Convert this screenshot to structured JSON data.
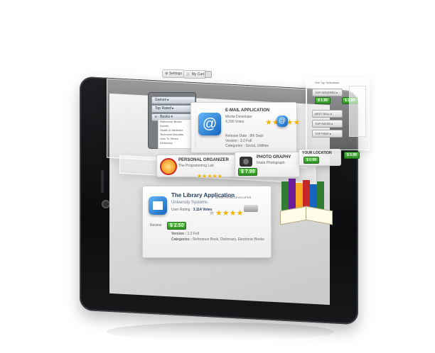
{
  "top_buttons": {
    "settings": "Settings",
    "cart": "My Cart"
  },
  "menu": {
    "items": [
      "Games ▸",
      "Top Rated ▸",
      "e - Books ▾"
    ],
    "sub_items": [
      "Reference Books",
      "Novels",
      "Health & Medicine",
      "Technical Manuals",
      "How To Series",
      "Dictionary"
    ]
  },
  "email_app": {
    "title": "E-MAIL APPLICATION",
    "publisher": "Media Developer",
    "rating": "4,290 Votes",
    "details": [
      "Release Date : 8th Sept",
      "Version : 3.0 Full",
      "Categories : Social, Utilities"
    ],
    "colors": {
      "icon": "#1e88e5"
    }
  },
  "personal_organizer": {
    "title": "PERSONAL ORGANIZER",
    "publisher": "The Programming Lab"
  },
  "photography": {
    "title": "PHOTO GRAPHY",
    "publisher": "Imala Photograph",
    "price": "$ 7.99"
  },
  "your_location": {
    "title": "YOUR LOCATION",
    "price": "$ 0.99"
  },
  "library_app": {
    "title": "The Library Application",
    "publisher": "University Systems",
    "user_rating_label": "User Rating :",
    "user_rating_value": "3,114 Votes",
    "more_label": "MORE FROM DEVELOPER",
    "review_label": "Review",
    "price": "$ 2.50",
    "version_label": "Version :",
    "version_value": "2.3 Full",
    "categories_label": "Categories :",
    "categories_value": "Reference Book, Dictionary, Electronic Books",
    "colors": {
      "icon": "#1e88e5"
    }
  },
  "right_panel": {
    "header": "See Top Selections",
    "items": [
      "TOP ORDERED ▸",
      "BEST SELL ▸",
      "TOP RATED ▸",
      "TOP FREE ▸"
    ],
    "prices": [
      "$ 1.99",
      "$ 2.99"
    ]
  },
  "location_side_price": "$ 0.99",
  "icons": [
    "email-app-icon",
    "alarm-clock-icon",
    "camera-icon",
    "library-books-icon",
    "open-book-icon"
  ]
}
